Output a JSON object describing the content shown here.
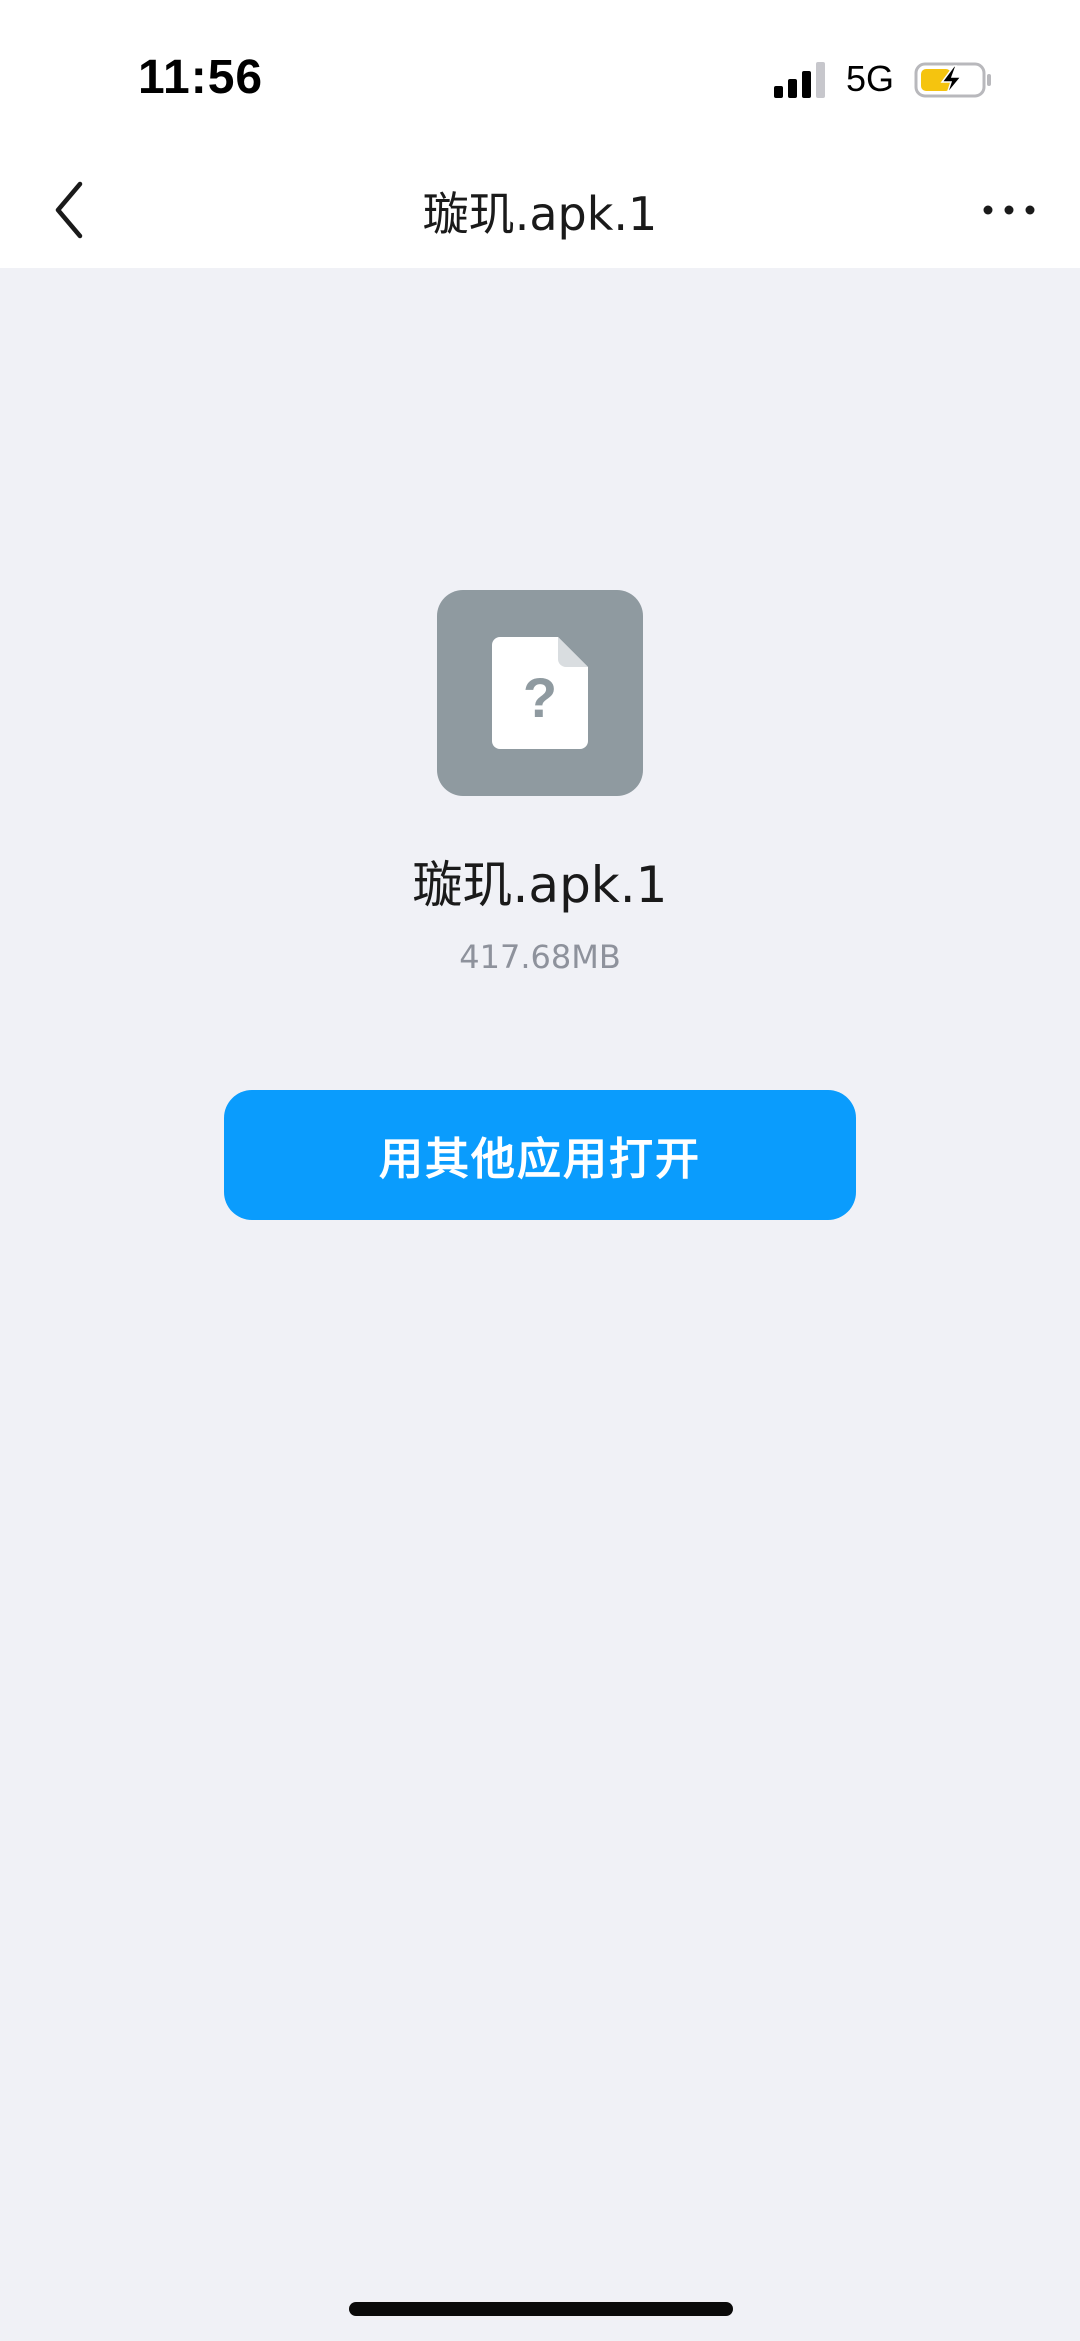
{
  "status_bar": {
    "time": "11:56",
    "network": "5G",
    "signal_icon": "signal-bars-icon",
    "battery_icon": "battery-charging-icon",
    "battery_color": "#f5c40f"
  },
  "nav": {
    "title": "璇玑.apk.1",
    "back_icon": "chevron-left-icon",
    "more_icon": "more-dots-icon"
  },
  "file": {
    "icon": "unknown-file-icon",
    "name": "璇玑.apk.1",
    "size": "417.68MB"
  },
  "actions": {
    "open_with_label": "用其他应用打开",
    "accent_color": "#0a9cfd"
  }
}
